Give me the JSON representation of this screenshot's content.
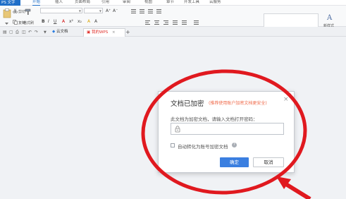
{
  "app": {
    "button_label": "PS 文字"
  },
  "menu": {
    "tabs": [
      {
        "label": "开始",
        "active": true
      },
      {
        "label": "插入"
      },
      {
        "label": "页面布局"
      },
      {
        "label": "引用"
      },
      {
        "label": "审阅"
      },
      {
        "label": "视图"
      },
      {
        "label": "章节"
      },
      {
        "label": "开发工具"
      },
      {
        "label": "云服务"
      }
    ]
  },
  "ribbon": {
    "cut_label": "剪切",
    "copy_label": "复制",
    "format_painter_label": "格式刷",
    "font_name": "",
    "font_size": "",
    "new_style_label": "新样式"
  },
  "doc_tabs": [
    {
      "label": "云文档",
      "active": false
    },
    {
      "label": "我的WPS",
      "active": true,
      "close": "×"
    }
  ],
  "new_tab_glyph": "+",
  "dialog": {
    "title": "文档已加密",
    "subtitle": "(推荐使用账户加密文档更安全)",
    "prompt": "此文档为加密文档，请输入文档打开密码：",
    "password_value": "",
    "auto_convert_label": "自动转化为账号加密文档",
    "auto_convert_checked": false,
    "help_glyph": "?",
    "ok_label": "确定",
    "cancel_label": "取消",
    "close_glyph": "×"
  },
  "colors": {
    "accent": "#1e6ec8",
    "annotation": "#e0191f",
    "subtitle": "#f06a4a",
    "ok_button": "#3b7fe0"
  },
  "icons": [
    "cut-icon",
    "copy-icon",
    "format-painter-icon",
    "paste-icon",
    "lock-icon",
    "close-icon",
    "help-icon",
    "new-style-icon"
  ]
}
